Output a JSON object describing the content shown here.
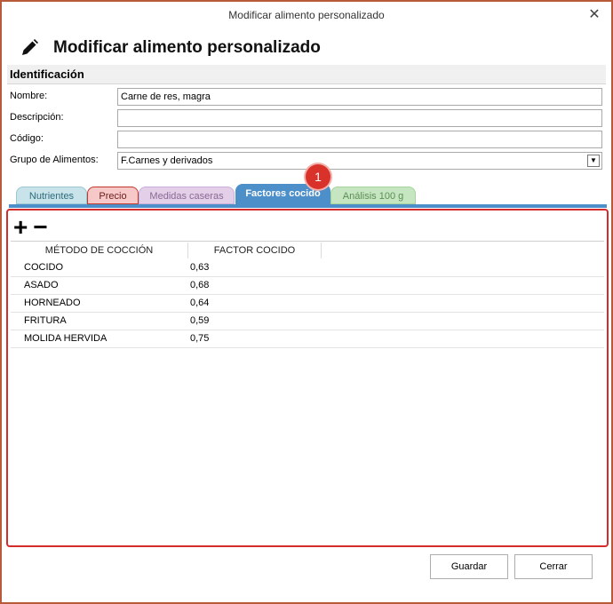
{
  "window": {
    "title": "Modificar alimento personalizado"
  },
  "header": {
    "title": "Modificar alimento personalizado"
  },
  "identification": {
    "section_title": "Identificación",
    "fields": [
      {
        "label": "Nombre:",
        "value": "Carne de res, magra"
      },
      {
        "label": "Descripción:",
        "value": ""
      },
      {
        "label": "Código:",
        "value": ""
      },
      {
        "label": "Grupo de Alimentos:",
        "value": "F.Carnes y derivados"
      }
    ]
  },
  "tabs": [
    {
      "label": "Nutrientes"
    },
    {
      "label": "Precio"
    },
    {
      "label": "Medidas caseras"
    },
    {
      "label": "Factores cocido",
      "active": true
    },
    {
      "label": "Análisis 100 g"
    }
  ],
  "badge": "1",
  "toolbar": {
    "add": "+",
    "remove": "−"
  },
  "table": {
    "columns": [
      "MÉTODO DE COCCIÓN",
      "FACTOR COCIDO"
    ],
    "rows": [
      {
        "method": "COCIDO",
        "factor": "0,63"
      },
      {
        "method": "ASADO",
        "factor": "0,68"
      },
      {
        "method": "HORNEADO",
        "factor": "0,64"
      },
      {
        "method": "FRITURA",
        "factor": "0,59"
      },
      {
        "method": "MOLIDA HERVIDA",
        "factor": "0,75"
      }
    ]
  },
  "buttons": {
    "save": "Guardar",
    "close": "Cerrar"
  },
  "colors": {
    "accent": "#4d8fc9",
    "highlight": "#d42b2b"
  }
}
